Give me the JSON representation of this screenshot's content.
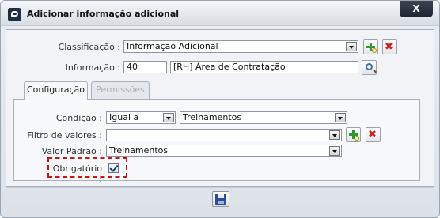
{
  "dialog": {
    "title": "Adicionar informação adicional",
    "close_label": "X"
  },
  "form": {
    "classificacao": {
      "label": "Classificação :",
      "value": "Informação Adicional"
    },
    "informacao": {
      "label": "Informação :",
      "code": "40",
      "description": "[RH] Área de Contratação"
    }
  },
  "tabs": [
    {
      "label": "Configuração",
      "active": true
    },
    {
      "label": "Permissões",
      "active": false
    }
  ],
  "config": {
    "condicao": {
      "label": "Condição :",
      "operator": "Igual a",
      "value": "Treinamentos"
    },
    "filtro": {
      "label": "Filtro de valores :",
      "value": ""
    },
    "valor_padrao": {
      "label": "Valor Padrão :",
      "value": "Treinamentos"
    },
    "obrigatorio": {
      "label": "Obrigatório :",
      "checked": true
    }
  },
  "icons": {
    "add": "add-magnifier-icon",
    "remove": "delete-x-icon",
    "search": "search-magnifier-icon",
    "save": "floppy-disk-icon"
  },
  "colors": {
    "required_highlight": "#d01414",
    "add_green": "#2f9a2f",
    "delete_red": "#d51e1e"
  }
}
